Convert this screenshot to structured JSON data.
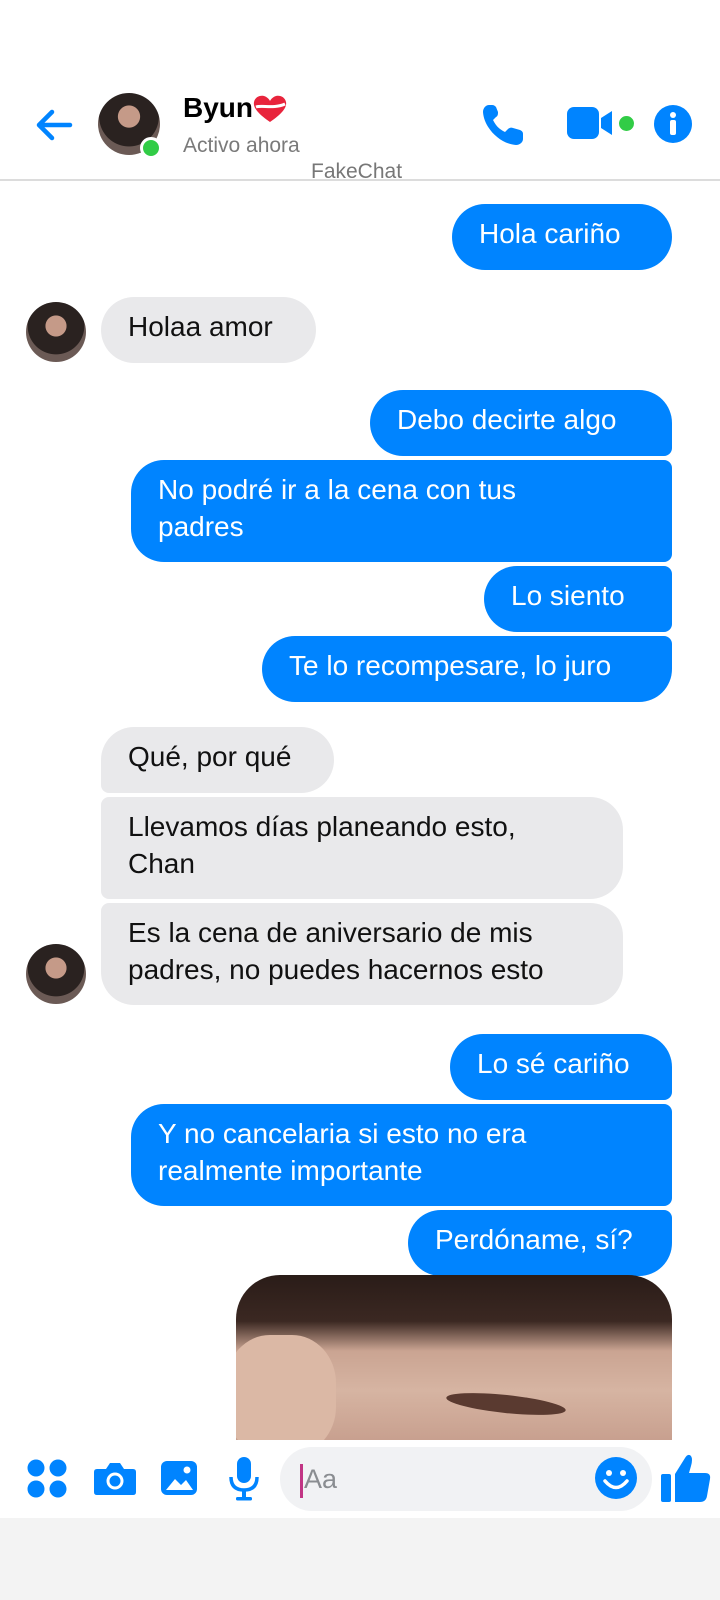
{
  "header": {
    "contact_name": "Byun",
    "status": "Activo ahora",
    "watermark": "FakeChat"
  },
  "messages": [
    {
      "from": "me",
      "text": "Hola cariño"
    },
    {
      "from": "them",
      "text": "Holaa amor"
    },
    {
      "from": "me",
      "text": "Debo decirte algo"
    },
    {
      "from": "me",
      "text": "No podré ir a la cena con tus\npadres"
    },
    {
      "from": "me",
      "text": "Lo siento"
    },
    {
      "from": "me",
      "text": "Te lo recompesare, lo juro"
    },
    {
      "from": "them",
      "text": "Qué, por qué"
    },
    {
      "from": "them",
      "text": "Llevamos días planeando esto,\nChan"
    },
    {
      "from": "them",
      "text": "Es la cena de aniversario de mis\npadres, no puedes hacernos esto"
    },
    {
      "from": "me",
      "text": "Lo sé cariño"
    },
    {
      "from": "me",
      "text": "Y no cancelaria si esto no era\nrealmente importante"
    },
    {
      "from": "me",
      "text": "Perdóname, sí?"
    }
  ],
  "composer": {
    "placeholder": "Aa"
  },
  "colors": {
    "accent": "#0084ff",
    "incoming_bubble": "#e9e9eb",
    "presence": "#31cc46"
  }
}
